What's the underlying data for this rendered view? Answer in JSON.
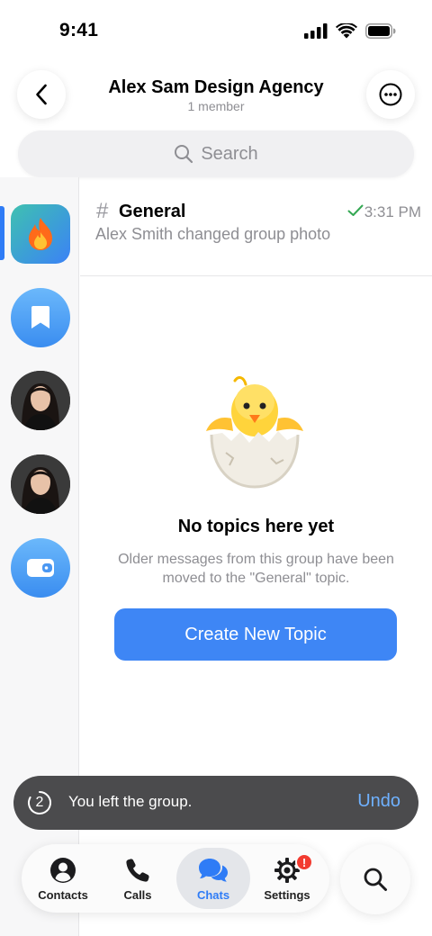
{
  "status_bar": {
    "time": "9:41"
  },
  "header": {
    "title": "Alex Sam Design Agency",
    "subtitle": "1 member"
  },
  "search": {
    "placeholder": "Search"
  },
  "topic": {
    "hash": "#",
    "name": "General",
    "time": "3:31 PM",
    "preview": "Alex Smith changed group photo"
  },
  "empty_state": {
    "title": "No topics here yet",
    "description": "Older messages from this group have been moved to the \"General\" topic.",
    "button_label": "Create New Topic"
  },
  "toast": {
    "countdown": "2",
    "message": "You left the group.",
    "undo_label": "Undo"
  },
  "tabbar": {
    "tabs": [
      {
        "label": "Contacts",
        "icon": "person-circle-icon"
      },
      {
        "label": "Calls",
        "icon": "phone-icon"
      },
      {
        "label": "Chats",
        "icon": "chat-bubbles-icon",
        "active": true
      },
      {
        "label": "Settings",
        "icon": "gear-icon",
        "badge": "!"
      }
    ]
  },
  "colors": {
    "accent": "#3e86f5",
    "toast_bg": "#4b4b4d",
    "undo": "#6fb1ff",
    "badge": "#f23b30"
  }
}
